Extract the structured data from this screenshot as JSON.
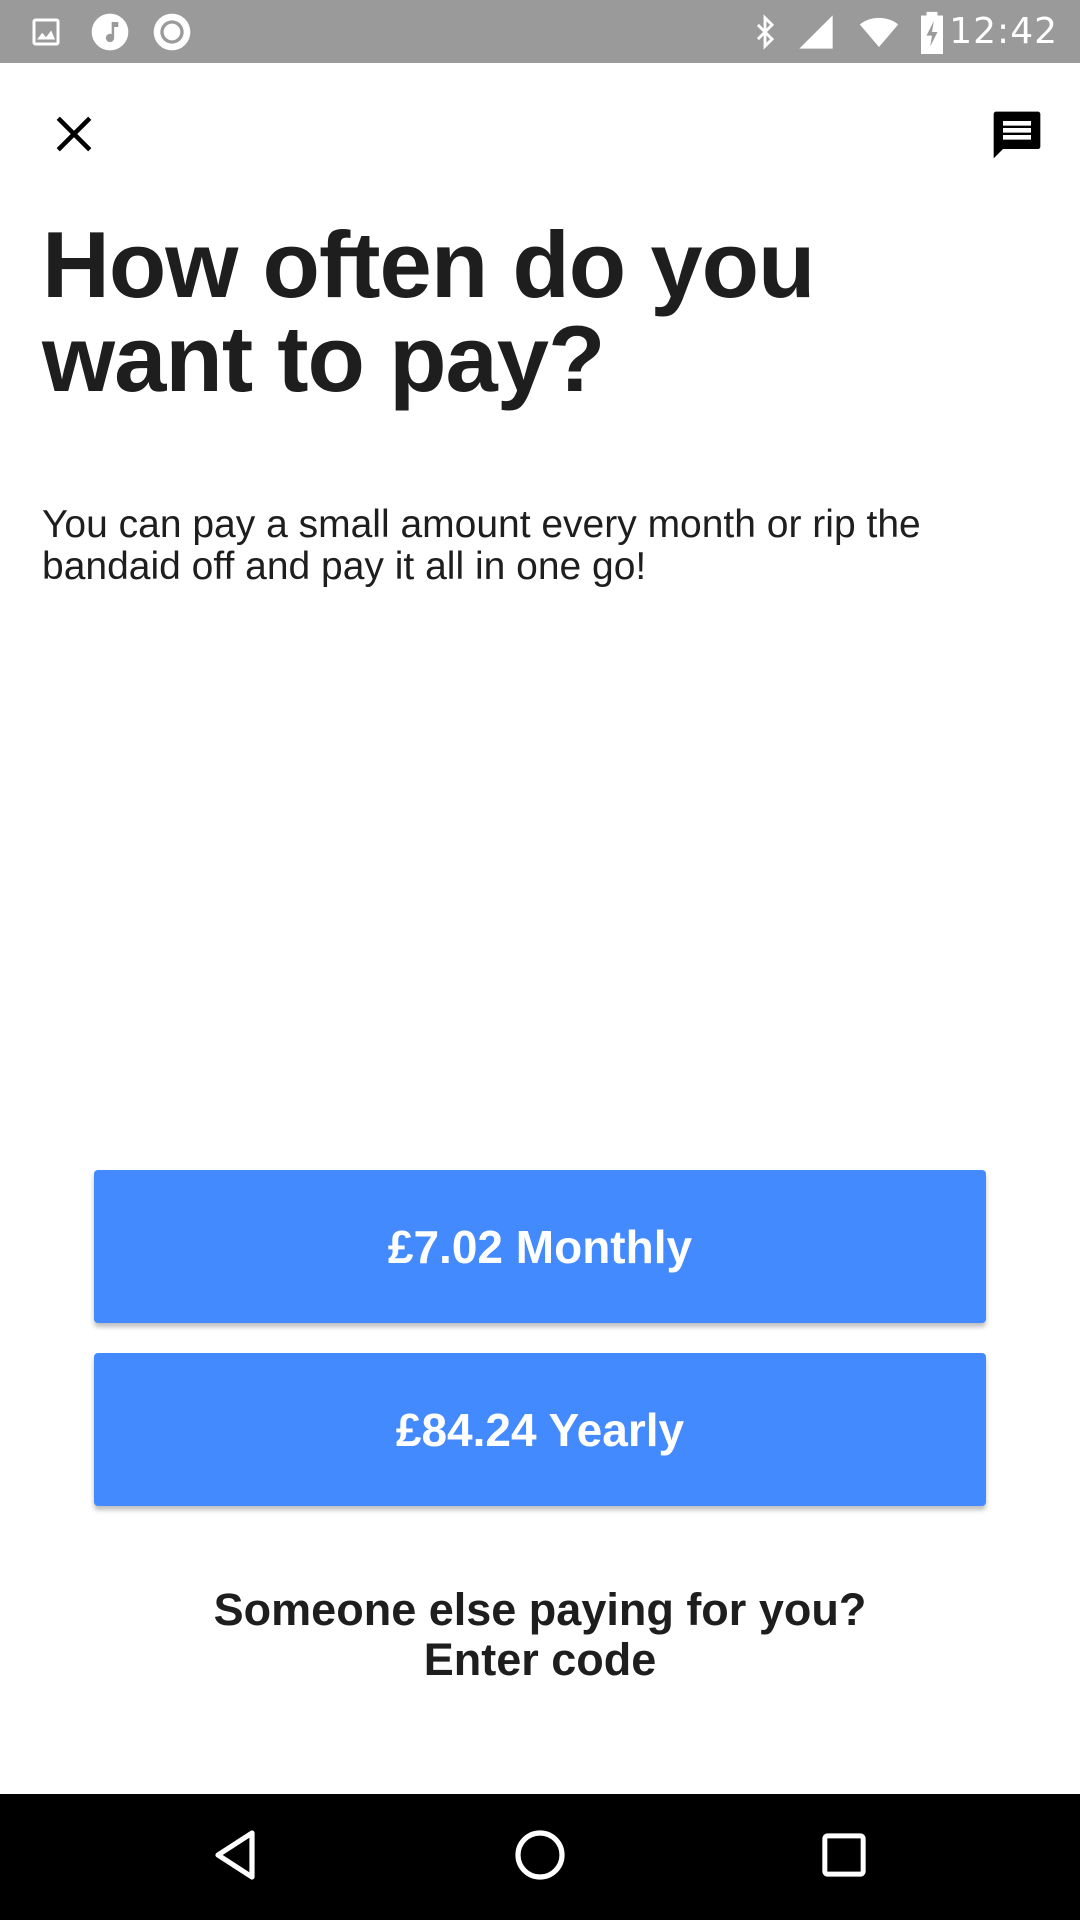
{
  "status_bar": {
    "time": "12:42",
    "left_icons": [
      "image-icon",
      "music-icon",
      "record-icon"
    ],
    "right_icons": [
      "bluetooth-icon",
      "signal-icon",
      "wifi-icon",
      "battery-charging-icon"
    ]
  },
  "app_bar": {
    "close_icon": "close-icon",
    "chat_icon": "chat-icon"
  },
  "main": {
    "title": "How often do you want to pay?",
    "subtitle": "You can pay a small amount every month or rip the bandaid off and pay it all in one go!",
    "monthly_button_label": "£7.02 Monthly",
    "yearly_button_label": "£84.24 Yearly",
    "someone_else_text": "Someone else paying for you?",
    "enter_code_label": "Enter code"
  },
  "nav_bar": {
    "icons": [
      "back-icon",
      "home-icon",
      "recents-icon"
    ]
  },
  "colors": {
    "status_bar": "#9a9a9a",
    "button_blue": "#448aff",
    "text": "#1e1e1e",
    "nav_bar": "#000000"
  }
}
